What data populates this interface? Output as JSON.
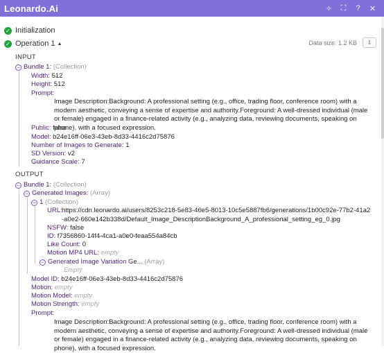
{
  "window": {
    "title": "Leonardo.Ai",
    "controls": {
      "sparkle": "✧",
      "fullscreen": "⛶",
      "help": "?",
      "close": "✕"
    }
  },
  "steps": {
    "initialization": "Initialization",
    "operation": "Operation 1",
    "data_size": "Data size: 1.2 KB",
    "download_icon": "⇩"
  },
  "input": {
    "heading": "INPUT",
    "bundle_label": "Bundle 1:",
    "collection": "(Collection)",
    "width_k": "Width:",
    "width_v": "512",
    "height_k": "Height:",
    "height_v": "512",
    "prompt_k": "Prompt:",
    "prompt_v": "Image Description:Background: A professional setting (e.g., office, trading floor, conference room) with a modern aesthetic, conveying a sense of expertise and authority.Foreground: A well-dressed individual (male or female) engaged in a finance-related activity (e.g., analyzing data, reviewing documents, speaking on phone), with a focused expression.",
    "public_k": "Public:",
    "public_v": "false",
    "model_k": "Model:",
    "model_v": "b24e16ff-06e3-43eb-8d33-4416c2d75876",
    "num_k": "Number of Images to Generate:",
    "num_v": "1",
    "sd_k": "SD Version:",
    "sd_v": "v2",
    "guid_k": "Guidance Scale:",
    "guid_v": "7"
  },
  "output": {
    "heading": "OUTPUT",
    "bundle_label": "Bundle 1:",
    "collection": "(Collection)",
    "gen_images_k": "Generated Images:",
    "array": "(Array)",
    "item1": "1",
    "url_k": "URL:",
    "url_v": "https://cdn.leonardo.ai/users/8253c218-5e83-46e5-8013-10c5e5887fb6/generations/1b00c92e-77b2-41a2-a0e2-660e142b338d/Default_Image_DescriptionBackground_A_professional_setting_eg_0.jpg",
    "nsfw_k": "NSFW:",
    "nsfw_v": "false",
    "id_k": "ID:",
    "id_v": "f7356860-14f4-4ca1-a0e0-feaa554a84cb",
    "like_k": "Like Count:",
    "like_v": "0",
    "mp4_k": "Motion MP4 URL:",
    "empty": "empty",
    "variation_k": "Generated Image Variation Ge...",
    "empty_cap": "Empty",
    "model_id_k": "Model ID:",
    "model_id_v": "b24e16ff-06e3-43eb-8d33-4416c2d75876",
    "motion_k": "Motion:",
    "motion_model_k": "Motion Model:",
    "motion_strength_k": "Motion Strength:",
    "prompt_k": "Prompt:",
    "prompt_v": "Image Description:Background: A professional setting (e.g., office, trading floor, conference room) with a modern aesthetic, conveying a sense of expertise and authority.Foreground: A well-dressed individual (male or female) engaged in a finance-related activity (e.g., analyzing data, reviewing documents, speaking on phone), with a focused expression."
  }
}
